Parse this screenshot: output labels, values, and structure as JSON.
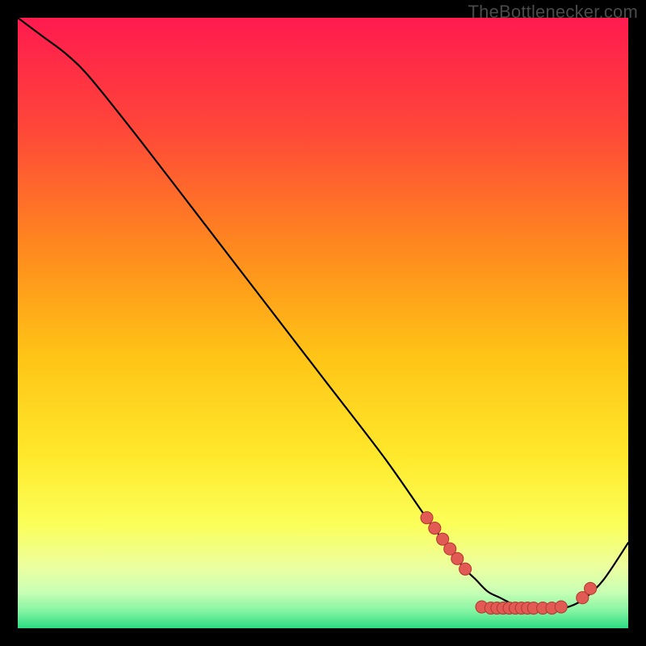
{
  "watermark": "TheBottlenecker.com",
  "colors": {
    "frame": "#000000",
    "gradient_stops": [
      {
        "offset": 0.0,
        "color": "#ff1a4f"
      },
      {
        "offset": 0.18,
        "color": "#ff4639"
      },
      {
        "offset": 0.38,
        "color": "#ff8a1e"
      },
      {
        "offset": 0.55,
        "color": "#ffc316"
      },
      {
        "offset": 0.72,
        "color": "#ffe92c"
      },
      {
        "offset": 0.83,
        "color": "#fbff59"
      },
      {
        "offset": 0.9,
        "color": "#ecffa0"
      },
      {
        "offset": 0.94,
        "color": "#c9ffb5"
      },
      {
        "offset": 0.97,
        "color": "#89f5a4"
      },
      {
        "offset": 1.0,
        "color": "#2bdc82"
      }
    ],
    "curve": "#000000",
    "marker_fill": "#e15b54",
    "marker_stroke": "#b1362e"
  },
  "chart_data": {
    "type": "line",
    "title": "",
    "xlabel": "",
    "ylabel": "",
    "xlim": [
      0,
      100
    ],
    "ylim": [
      0,
      100
    ],
    "series": [
      {
        "name": "curve",
        "x": [
          0,
          4,
          8,
          12,
          20,
          30,
          40,
          50,
          60,
          67,
          70,
          73,
          75,
          77,
          79,
          81,
          83,
          85,
          87,
          89,
          91,
          93,
          96,
          100
        ],
        "y": [
          100,
          97,
          94,
          90,
          80,
          67,
          54,
          41,
          28,
          18,
          14,
          10,
          8,
          6,
          5,
          4,
          3.5,
          3,
          3,
          3.2,
          3.8,
          5,
          8,
          14
        ]
      }
    ],
    "markers": [
      {
        "x": 67.0,
        "y": 18.1
      },
      {
        "x": 68.3,
        "y": 16.4
      },
      {
        "x": 69.6,
        "y": 14.6
      },
      {
        "x": 70.8,
        "y": 13.0
      },
      {
        "x": 72.0,
        "y": 11.4
      },
      {
        "x": 73.3,
        "y": 9.7
      },
      {
        "x": 76.0,
        "y": 3.5
      },
      {
        "x": 77.5,
        "y": 3.3
      },
      {
        "x": 78.5,
        "y": 3.3
      },
      {
        "x": 79.5,
        "y": 3.3
      },
      {
        "x": 80.5,
        "y": 3.3
      },
      {
        "x": 81.5,
        "y": 3.3
      },
      {
        "x": 82.5,
        "y": 3.3
      },
      {
        "x": 83.5,
        "y": 3.3
      },
      {
        "x": 84.5,
        "y": 3.3
      },
      {
        "x": 86.0,
        "y": 3.3
      },
      {
        "x": 87.5,
        "y": 3.3
      },
      {
        "x": 89.0,
        "y": 3.5
      },
      {
        "x": 92.5,
        "y": 5.0
      },
      {
        "x": 93.8,
        "y": 6.5
      }
    ],
    "marker_radius": 1.0
  }
}
